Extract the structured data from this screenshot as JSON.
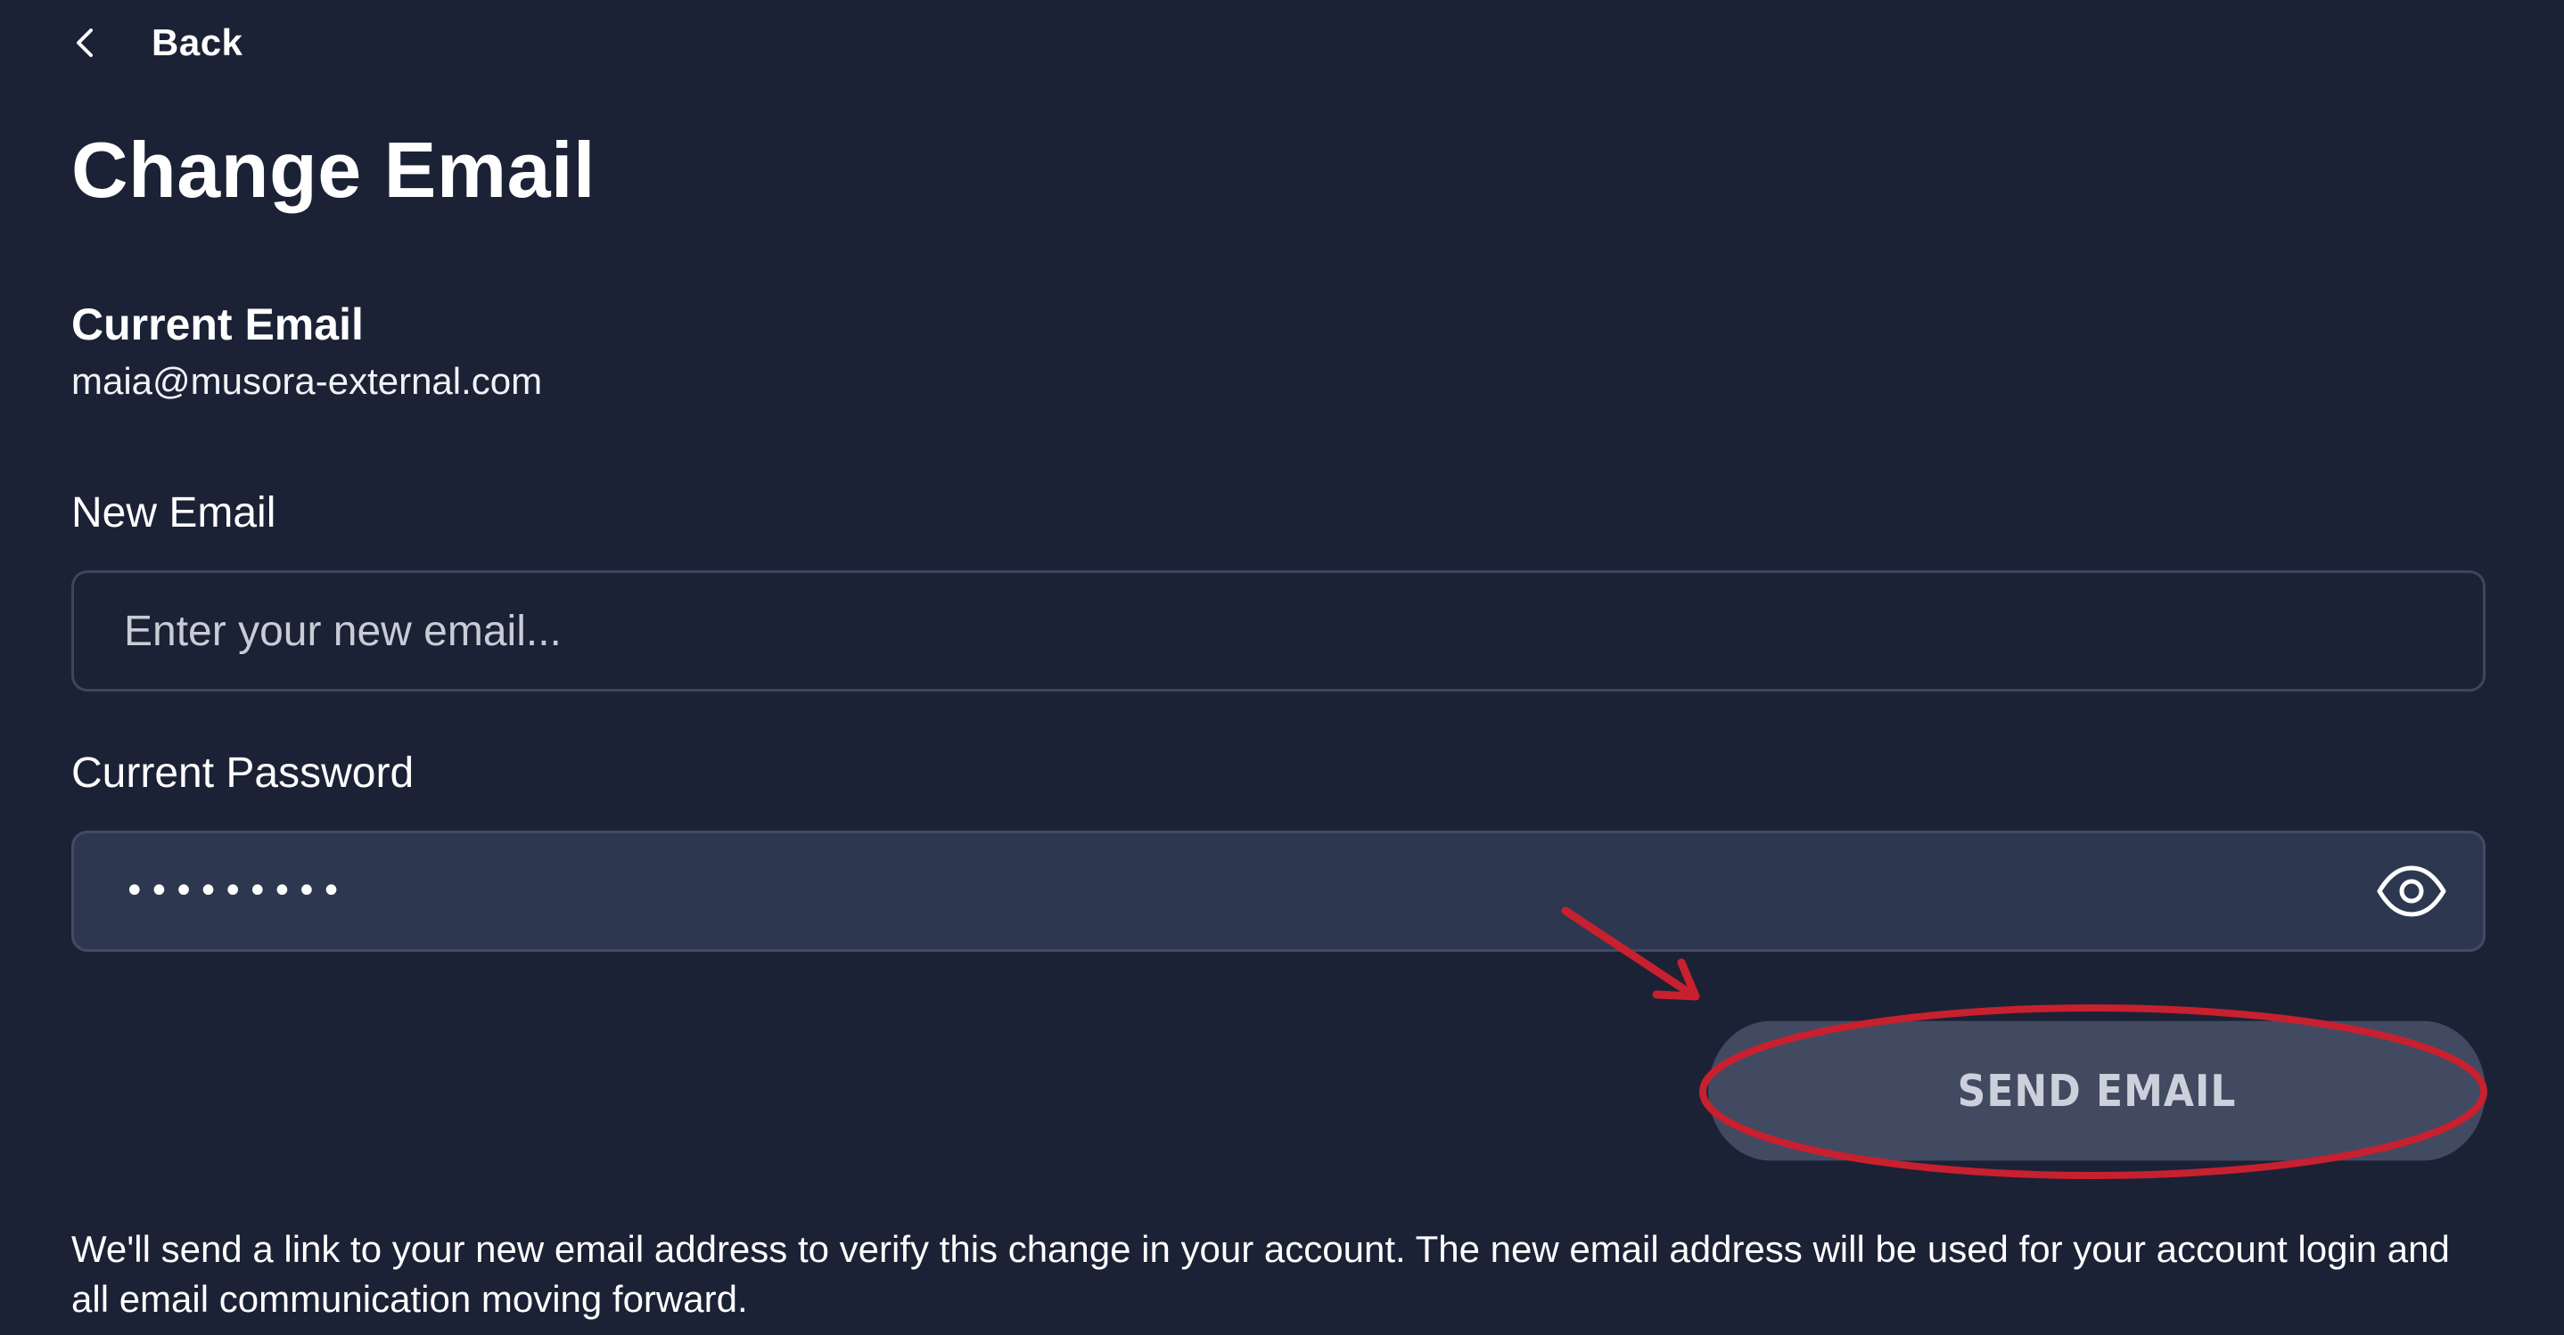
{
  "nav": {
    "back_label": "Back"
  },
  "page": {
    "title": "Change Email"
  },
  "current_email": {
    "label": "Current Email",
    "value": "maia@musora-external.com"
  },
  "new_email": {
    "label": "New Email",
    "placeholder": "Enter your new email...",
    "value": ""
  },
  "current_password": {
    "label": "Current Password",
    "value": "•••••••••"
  },
  "actions": {
    "send_label": "SEND EMAIL"
  },
  "info": {
    "text": "We'll send a link to your new email address to verify this change in your account. The new email address will be used for your account login and all email communication moving forward."
  },
  "icons": {
    "back": "chevron-left-icon",
    "password_toggle": "eye-icon"
  },
  "colors": {
    "background": "#1b2235",
    "input_border": "#3d465c",
    "password_fill": "#2d3850",
    "button_fill": "#414a61",
    "button_text": "#cbd0da",
    "annotation": "#c8202f"
  }
}
